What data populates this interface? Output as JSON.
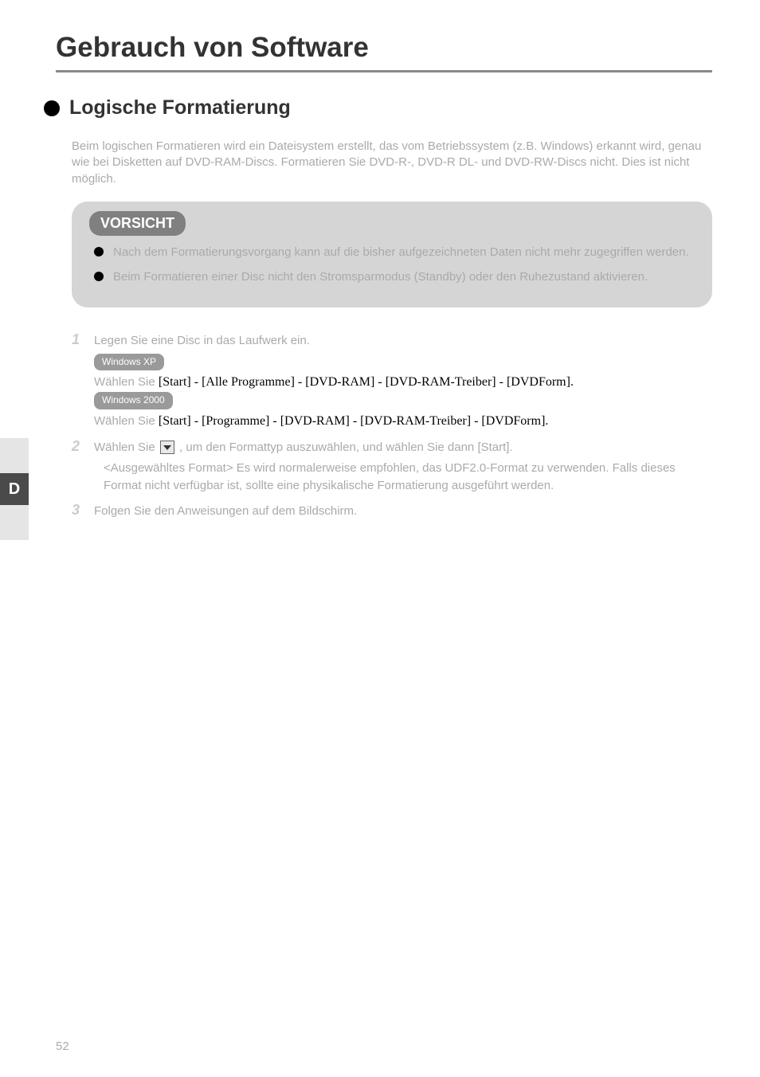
{
  "title": "Gebrauch von Software",
  "section": {
    "heading": "Logische Formatierung",
    "intro": "Beim logischen Formatieren wird ein Dateisystem erstellt, das vom Betriebssystem (z.B. Windows) erkannt wird, genau wie bei Disketten auf DVD-RAM-Discs.\nFormatieren Sie DVD-R-, DVD-R DL- und DVD-RW-Discs nicht. Dies ist nicht möglich."
  },
  "caution": {
    "label": "VORSICHT",
    "items": [
      "Nach dem Formatierungsvorgang kann auf die bisher aufgezeichneten Daten nicht mehr zugegriffen werden.",
      "Beim Formatieren einer Disc nicht den Stromsparmodus (Standby) oder den Ruhezustand aktivieren."
    ]
  },
  "steps": [
    {
      "num": "1",
      "title": "Legen Sie eine Disc in das Laufwerk ein.",
      "body_prefix_xp": "Windows XP",
      "body_xp_1": "Wählen Sie ",
      "body_xp_serif": "[Start] - [Alle Programme] - [DVD-RAM] - [DVD-RAM-Treiber] - [DVDForm].",
      "body_prefix_2k": "Windows 2000",
      "body_2k_1": "Wählen Sie ",
      "body_2k_serif": "[Start] - [Programme] - [DVD-RAM] - [DVD-RAM-Treiber] - [DVDForm]."
    },
    {
      "num": "2",
      "title_1": "Wählen Sie ",
      "title_2": ", um den Formattyp auszuwählen, und wählen Sie dann [Start].",
      "body": "<Ausgewähltes Format>\nEs wird normalerweise empfohlen, das UDF2.0-Format zu verwenden. Falls dieses Format nicht verfügbar ist, sollte eine physikalische Formatierung ausgeführt werden."
    },
    {
      "num": "3",
      "title": "Folgen Sie den Anweisungen auf dem Bildschirm."
    }
  ],
  "sideTab": "D",
  "pageNumber": "52"
}
